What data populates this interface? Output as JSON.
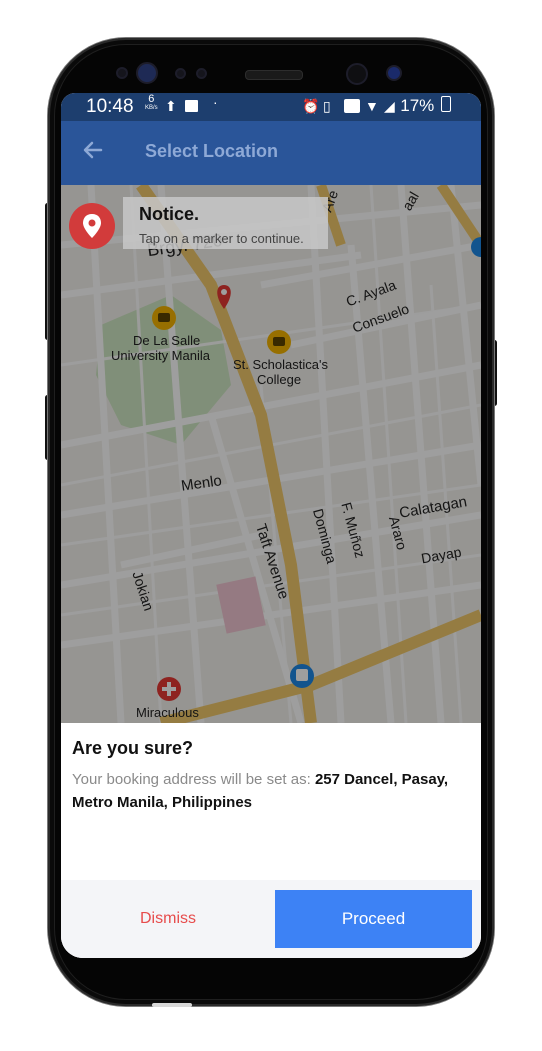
{
  "status_bar": {
    "time": "10:48",
    "speed_value": "6",
    "speed_unit": "KB/s",
    "battery": "17%",
    "icons": [
      "upload-icon",
      "image-icon",
      "dot-icon",
      "alarm-icon",
      "vibrate-icon",
      "volte-icon",
      "wifi-icon",
      "signal-icon",
      "battery-icon"
    ]
  },
  "app_bar": {
    "title": "Select Location",
    "back_icon": "back-arrow-icon"
  },
  "notice": {
    "title": "Notice.",
    "message": "Tap on a marker to continue."
  },
  "map": {
    "labels": {
      "dlsu": "De La Salle University Manila",
      "dlsu_line1": "De La Salle",
      "dlsu_line2": "University Manila",
      "scholastica_line1": "St. Scholastica's",
      "scholastica_line2": "College",
      "cayala": "C. Ayala",
      "consuelo": "Consuelo",
      "menlo": "Menlo",
      "taft": "Taft Avenue",
      "dominga": "Dominga",
      "fmunoz": "F. Muñoz",
      "araro": "Araro",
      "calatagan": "Calatagan",
      "dayap": "Dayap",
      "jokian": "Jokian",
      "miraculous": "Miraculous",
      "brgy": "Brgy. 720",
      "arellano": "Are",
      "aal": "aal"
    },
    "colors": {
      "road_major": "#f1c96b",
      "road_minor": "#ffffff",
      "land": "#f3f1ec",
      "park": "#cfe7c3",
      "marker_red": "#e53935",
      "school_marker": "#f4b400",
      "transit_marker": "#1e88e5"
    }
  },
  "dialog": {
    "title": "Are you sure?",
    "prefix": "Your booking address will be set as: ",
    "address": "257 Dancel, Pasay, Metro Manila, Philippines",
    "dismiss_label": "Dismiss",
    "proceed_label": "Proceed"
  }
}
